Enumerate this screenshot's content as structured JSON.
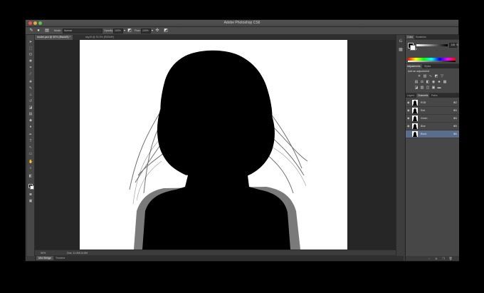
{
  "app": {
    "title": "Adobe Photoshop CS6",
    "workspace": "Essentials"
  },
  "options_bar": {
    "mode_label": "Mode:",
    "mode_value": "Normal",
    "opacity_label": "Opacity:",
    "opacity_value": "100%",
    "flow_label": "Flow:",
    "flow_value": "100%"
  },
  "document_tabs": [
    {
      "label": "model.psd @ 50% (Black/8) *",
      "active": true
    },
    {
      "label": "sky.tif @ 33.3% (RGB/8*)",
      "active": false
    }
  ],
  "status_bar": {
    "zoom": "50%",
    "doc_info": "Doc: 11.9M/14.8M"
  },
  "bottom_tabs": [
    {
      "label": "Mini Bridge",
      "active": true
    },
    {
      "label": "Timeline",
      "active": false
    }
  ],
  "color_panel": {
    "tabs": [
      {
        "label": "Color",
        "active": true
      },
      {
        "label": "Swatches",
        "active": false
      }
    ],
    "k_label": "K",
    "k_value": "100",
    "k_unit": "%",
    "foreground": "#000000",
    "background": "#ffffff"
  },
  "adjustments_panel": {
    "tabs": [
      {
        "label": "Adjustments",
        "active": true
      },
      {
        "label": "Styles",
        "active": false
      }
    ],
    "title": "Add an adjustment"
  },
  "layers_panel": {
    "tabs": [
      {
        "label": "Layers",
        "active": false
      },
      {
        "label": "Channels",
        "active": true
      },
      {
        "label": "Paths",
        "active": false
      }
    ],
    "channels": [
      {
        "name": "RGB",
        "shortcut": "⌘2",
        "selected": false
      },
      {
        "name": "Red",
        "shortcut": "⌘3",
        "selected": false
      },
      {
        "name": "Green",
        "shortcut": "⌘4",
        "selected": false
      },
      {
        "name": "Blue",
        "shortcut": "⌘5",
        "selected": false
      },
      {
        "name": "Black",
        "shortcut": "⌘6",
        "selected": true
      }
    ]
  }
}
